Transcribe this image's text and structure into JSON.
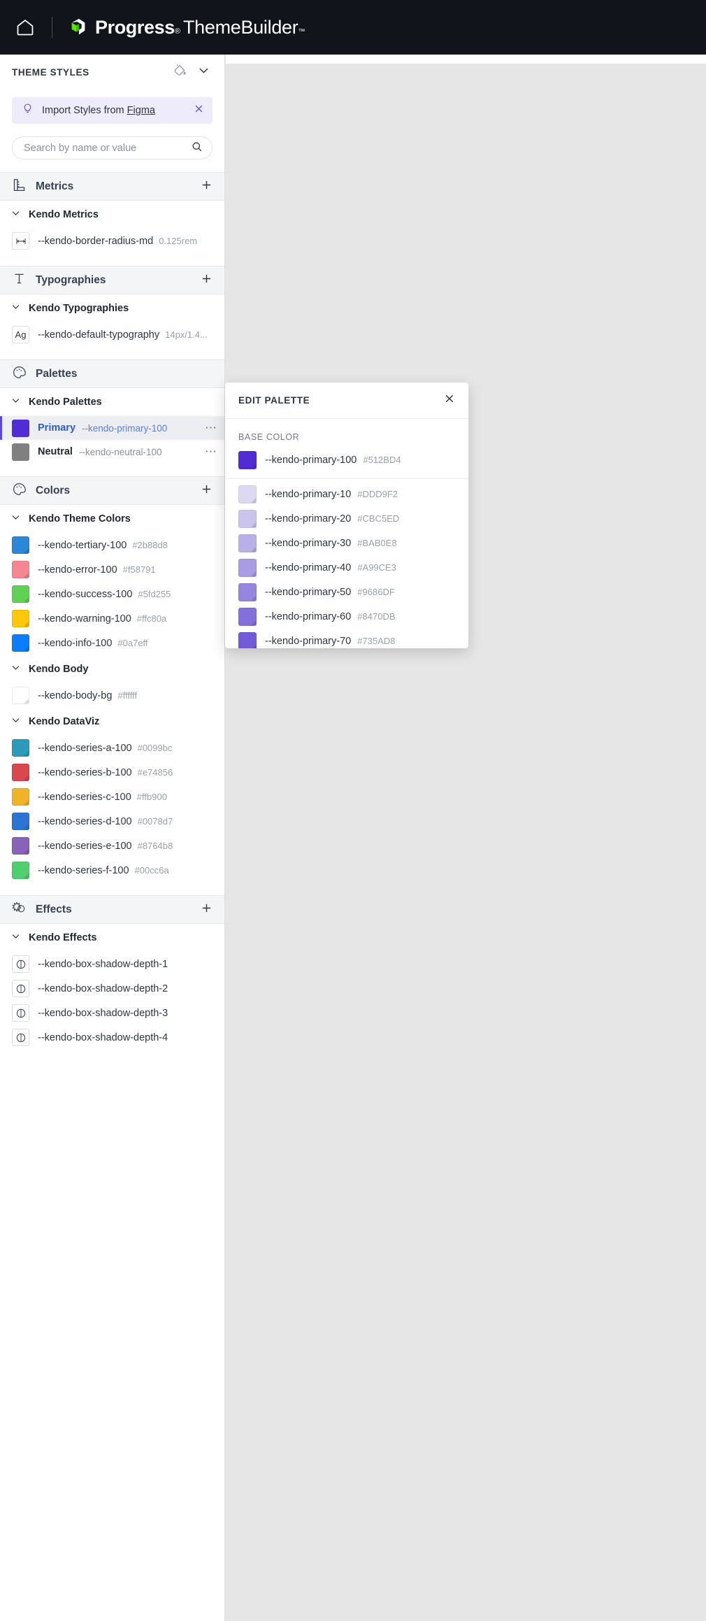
{
  "topbar": {
    "home_icon": "home-icon",
    "brand_progress": "Progress",
    "brand_reg": "®",
    "brand_themebuilder": "ThemeBuilder",
    "brand_tm": "™"
  },
  "sidebar": {
    "title": "THEME STYLES",
    "paint_icon": "paint-bucket-icon",
    "chevron_icon": "chevron-down-icon",
    "figma_banner": {
      "icon": "lightbulb-icon",
      "text_prefix": "Import Styles from ",
      "link": "Figma",
      "close_icon": "close-icon"
    },
    "search": {
      "placeholder": "Search by name or value",
      "value": "",
      "icon": "search-icon"
    },
    "sections": [
      {
        "id": "metrics",
        "label": "Metrics",
        "icon": "ruler-icon",
        "add_label": "+",
        "groups": [
          {
            "label": "Kendo Metrics",
            "rows": [
              {
                "icon": "width-arrow-icon",
                "name": "--kendo-border-radius-md",
                "value": "0.125rem"
              }
            ]
          }
        ]
      },
      {
        "id": "typographies",
        "label": "Typographies",
        "icon": "text-icon",
        "add_label": "+",
        "groups": [
          {
            "label": "Kendo Typographies",
            "rows": [
              {
                "icon": "Ag",
                "name": "--kendo-default-typography",
                "value": "14px/1.4..."
              }
            ]
          }
        ]
      },
      {
        "id": "palettes",
        "label": "Palettes",
        "icon": "palette-icon",
        "add_label": "",
        "groups": [
          {
            "label": "Kendo Palettes",
            "palettes": [
              {
                "title": "Primary",
                "var": "--kendo-primary-100",
                "color": "#512BD4",
                "selected": true,
                "menu": "⋯"
              },
              {
                "title": "Neutral",
                "var": "--kendo-neutral-100",
                "color": "#808080",
                "selected": false,
                "menu": "⋯"
              }
            ]
          }
        ]
      },
      {
        "id": "colors",
        "label": "Colors",
        "icon": "palette-icon",
        "add_label": "+",
        "groups": [
          {
            "label": "Kendo Theme Colors",
            "rows": [
              {
                "name": "--kendo-tertiary-100",
                "value": "#2b88d8",
                "color": "#2b88d8"
              },
              {
                "name": "--kendo-error-100",
                "value": "#f58791",
                "color": "#f58791"
              },
              {
                "name": "--kendo-success-100",
                "value": "#5fd255",
                "color": "#5fd255"
              },
              {
                "name": "--kendo-warning-100",
                "value": "#ffc80a",
                "color": "#ffc80a"
              },
              {
                "name": "--kendo-info-100",
                "value": "#0a7eff",
                "color": "#0a7eff"
              }
            ]
          },
          {
            "label": "Kendo Body",
            "rows": [
              {
                "name": "--kendo-body-bg",
                "value": "#ffffff",
                "color": "#ffffff"
              }
            ]
          },
          {
            "label": "Kendo DataViz",
            "rows": [
              {
                "name": "--kendo-series-a-100",
                "value": "#0099bc",
                "color": "#2a9cba"
              },
              {
                "name": "--kendo-series-b-100",
                "value": "#e74856",
                "color": "#d9474f"
              },
              {
                "name": "--kendo-series-c-100",
                "value": "#ffb900",
                "color": "#f0b429"
              },
              {
                "name": "--kendo-series-d-100",
                "value": "#0078d7",
                "color": "#2b74d4"
              },
              {
                "name": "--kendo-series-e-100",
                "value": "#8764b8",
                "color": "#8764b8"
              },
              {
                "name": "--kendo-series-f-100",
                "value": "#00cc6a",
                "color": "#4fcf6e"
              }
            ]
          }
        ]
      },
      {
        "id": "effects",
        "label": "Effects",
        "icon": "effects-icon",
        "add_label": "+",
        "groups": [
          {
            "label": "Kendo Effects",
            "rows": [
              {
                "icon": "contrast-circle-icon",
                "name": "--kendo-box-shadow-depth-1",
                "value": ""
              },
              {
                "icon": "contrast-circle-icon",
                "name": "--kendo-box-shadow-depth-2",
                "value": ""
              },
              {
                "icon": "contrast-circle-icon",
                "name": "--kendo-box-shadow-depth-3",
                "value": ""
              },
              {
                "icon": "contrast-circle-icon",
                "name": "--kendo-box-shadow-depth-4",
                "value": ""
              }
            ]
          }
        ]
      }
    ]
  },
  "popup": {
    "title": "EDIT PALETTE",
    "close_icon": "close-icon",
    "base_color_label": "BASE COLOR",
    "base": {
      "name": "--kendo-primary-100",
      "value": "#512BD4",
      "color": "#512BD4"
    },
    "shades": [
      {
        "name": "--kendo-primary-10",
        "value": "#DDD9F2",
        "color": "#DDD9F2"
      },
      {
        "name": "--kendo-primary-20",
        "value": "#CBC5ED",
        "color": "#CBC5ED"
      },
      {
        "name": "--kendo-primary-30",
        "value": "#BAB0E8",
        "color": "#BAB0E8"
      },
      {
        "name": "--kendo-primary-40",
        "value": "#A99CE3",
        "color": "#A99CE3"
      },
      {
        "name": "--kendo-primary-50",
        "value": "#9686DF",
        "color": "#9686DF"
      },
      {
        "name": "--kendo-primary-60",
        "value": "#8470DB",
        "color": "#8470DB"
      },
      {
        "name": "--kendo-primary-70",
        "value": "#735AD8",
        "color": "#735AD8"
      }
    ]
  },
  "colors": {
    "accent": "#512BD4",
    "topbar_bg": "#11141a",
    "sidebar_bg": "#ffffff",
    "canvas_bg": "#e6e6e6"
  }
}
